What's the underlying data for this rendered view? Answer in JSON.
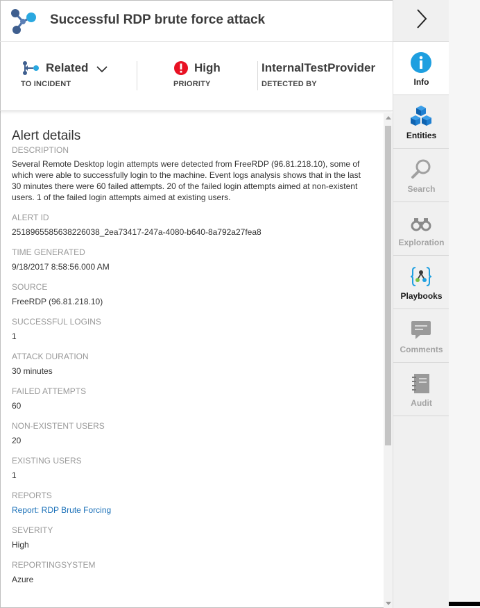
{
  "header": {
    "title": "Successful RDP brute force attack",
    "icon": "alert-graph-icon"
  },
  "summary": {
    "incident": {
      "value": "Related",
      "label": "TO INCIDENT",
      "icon": "related-incident-icon"
    },
    "priority": {
      "value": "High",
      "label": "PRIORITY",
      "icon": "exclamation-icon",
      "color": "#e81123"
    },
    "detected": {
      "value": "InternalTestProvider",
      "label": "DETECTED BY"
    }
  },
  "rail": {
    "collapse_icon": "chevron-right-icon",
    "items": [
      {
        "label": "Info",
        "icon": "info-icon",
        "state": "active"
      },
      {
        "label": "Entities",
        "icon": "cubes-icon",
        "state": "enabled"
      },
      {
        "label": "Search",
        "icon": "search-icon",
        "state": "disabled"
      },
      {
        "label": "Exploration",
        "icon": "binoculars-icon",
        "state": "disabled"
      },
      {
        "label": "Playbooks",
        "icon": "playbook-icon",
        "state": "enabled"
      },
      {
        "label": "Comments",
        "icon": "comment-icon",
        "state": "disabled"
      },
      {
        "label": "Audit",
        "icon": "notebook-icon",
        "state": "disabled"
      }
    ]
  },
  "details": {
    "title": "Alert details",
    "description_label": "DESCRIPTION",
    "description": "Several Remote Desktop login attempts were detected from FreeRDP (96.81.218.10), some of which were able to successfully login to the machine. Event logs analysis shows that in the last 30 minutes there were 60 failed attempts. 20 of the failed login attempts aimed at non-existent users. 1 of the failed login attempts aimed at existing users.",
    "fields": [
      {
        "label": "ALERT ID",
        "value": "2518965585638226038_2ea73417-247a-4080-b640-8a792a27fea8"
      },
      {
        "label": "TIME GENERATED",
        "value": "9/18/2017 8:58:56.000 AM"
      },
      {
        "label": "SOURCE",
        "value": "FreeRDP (96.81.218.10)"
      },
      {
        "label": "SUCCESSFUL LOGINS",
        "value": "1"
      },
      {
        "label": "ATTACK DURATION",
        "value": "30 minutes"
      },
      {
        "label": "FAILED ATTEMPTS",
        "value": "60"
      },
      {
        "label": "NON-EXISTENT USERS",
        "value": "20"
      },
      {
        "label": "EXISTING USERS",
        "value": "1"
      },
      {
        "label": "REPORTS",
        "value": "Report: RDP Brute Forcing"
      },
      {
        "label": "SEVERITY",
        "value": "High"
      },
      {
        "label": "REPORTINGSYSTEM",
        "value": "Azure"
      }
    ]
  },
  "colors": {
    "accent_blue": "#0078d7",
    "link": "#1a70b8",
    "danger": "#e81123"
  }
}
